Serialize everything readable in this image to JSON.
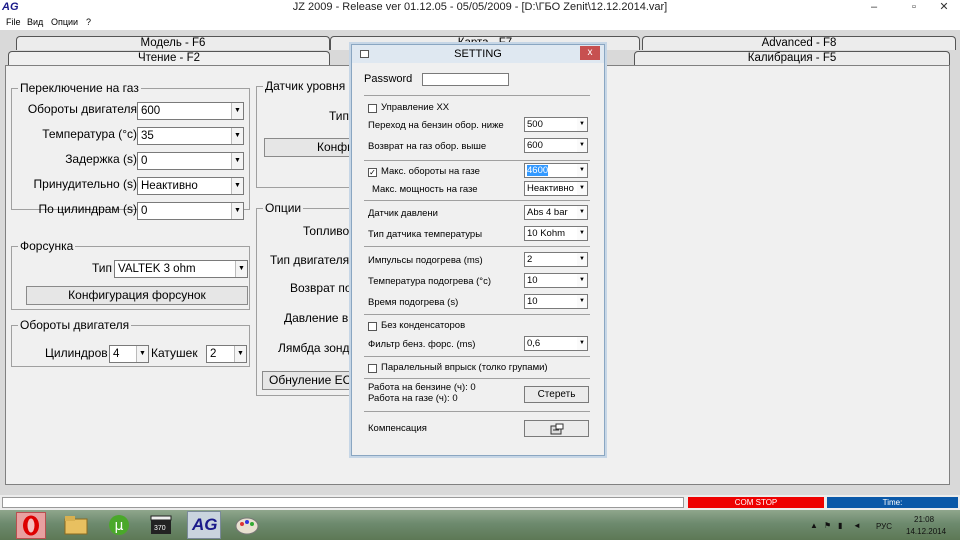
{
  "window": {
    "logo": "AG",
    "title": "JZ 2009  -  Release  ver 01.12.05 - 05/05/2009  - [D:\\ГБО Zenit\\12.12.2014.var]",
    "min": "–",
    "max": "▫",
    "close": "✕"
  },
  "menu": [
    "File",
    "Вид",
    "Опции",
    "?"
  ],
  "tabs": {
    "model": "Модель - F6",
    "card": "Карта - F7",
    "advanced": "Advanced - F8",
    "read": "Чтение - F2",
    "calib": "Калибрация - F5"
  },
  "switch_group": {
    "title": "Переключение на газ",
    "rows": [
      {
        "label": "Обороты двигателя",
        "value": "600"
      },
      {
        "label": "Температура (°c)",
        "value": "35"
      },
      {
        "label": "Задержка (s)",
        "value": "0"
      },
      {
        "label": "Принудительно (s)",
        "value": "Неактивно"
      },
      {
        "label": "По цилиндрам (s)",
        "value": "0"
      }
    ]
  },
  "injector_group": {
    "title": "Форсунка",
    "type_label": "Тип",
    "type_value": "VALTEK 3 ohm",
    "config_button": "Конфигурация форсунок"
  },
  "rpm_group": {
    "title": "Обороты двигателя",
    "cyl_label": "Цилиндров",
    "cyl_value": "4",
    "coil_label": "Катушек",
    "coil_value": "2"
  },
  "level_group": {
    "title": "Датчик уровня газ",
    "type_label": "Тип",
    "config_button": "Конфи"
  },
  "options_group": {
    "title": "Опции",
    "labels": [
      "Топливо",
      "Тип двигателя",
      "Возврат по",
      "Давление в",
      "Лямбда зонд"
    ],
    "reset_button": "Обнуление ECU"
  },
  "dialog": {
    "title": "SETTING",
    "close": "x",
    "password_label": "Password",
    "password_value": "",
    "idle_label": "Управление XX",
    "switch_petrol_label": "Переход на бензин обор. ниже",
    "switch_petrol_value": "500",
    "return_gas_label": "Возврат на газ обор. выше",
    "return_gas_value": "600",
    "max_rpm_label": "Макс. обороты на газе",
    "max_rpm_value": "4600",
    "max_power_label": "Макс. мощность на газе",
    "max_power_value": "Неактивно",
    "pressure_label": "Датчик давлени",
    "pressure_value": "Abs 4 bar",
    "temp_sensor_label": "Тип датчика температуры",
    "temp_sensor_value": "10 Kohm",
    "heat_pulses_label": "Импульсы подогрева (ms)",
    "heat_pulses_value": "2",
    "heat_temp_label": "Температура подогрева (°c)",
    "heat_temp_value": "10",
    "heat_time_label": "Время подогрева (s)",
    "heat_time_value": "10",
    "no_caps_label": "Без конденсаторов",
    "filter_label": "Фильтр бенз. форс. (ms)",
    "filter_value": "0,6",
    "parallel_label": "Паралельный впрыск (толко групами)",
    "work_petrol": "Работа на бензине (ч): 0",
    "work_gas": "Работа на газе (ч): 0",
    "erase_button": "Стереть",
    "comp_label": "Компенсация"
  },
  "status": {
    "com": "COM STOP",
    "time": "Time:"
  },
  "taskbar": {
    "lang": "РУС",
    "clock": "21:08",
    "date": "14.12.2014",
    "icon_label": "370"
  },
  "colors": {
    "com_stop": "#ee0000",
    "time_bg": "#0a58a8",
    "selection": "#3399ff"
  }
}
